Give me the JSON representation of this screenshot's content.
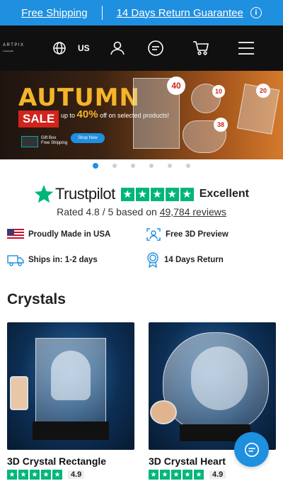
{
  "promo": {
    "free_shipping": "Free Shipping",
    "returns": "14 Days Return Guarantee",
    "info_icon": "info-icon"
  },
  "nav": {
    "logo_text": "ARTPIX",
    "logo_sub": "crystal gifts",
    "region": "US",
    "icons": [
      "globe-icon",
      "user-icon",
      "chat-icon",
      "cart-icon",
      "menu-icon"
    ]
  },
  "hero": {
    "headline": "AUTUMN",
    "sale": "SALE",
    "sale_detail_pre": "up to",
    "sale_percent": "40%",
    "sale_detail_post": "off on selected products!",
    "gift_line1": "Gift Box",
    "gift_line2": "Free Shipping",
    "shop_button": "Shop Now",
    "tag_40": "40",
    "tag_10": "10",
    "tag_20": "20",
    "tag_38": "38"
  },
  "carousel": {
    "count": 6,
    "active": 0
  },
  "trustpilot": {
    "brand": "Trustpilot",
    "rating_word": "Excellent",
    "rated_prefix": "Rated 4.8 / 5 based on ",
    "reviews": "49,784 reviews"
  },
  "features": [
    {
      "icon": "usa-flag-icon",
      "label": "Proudly Made in USA"
    },
    {
      "icon": "preview-3d-icon",
      "label": "Free 3D Preview"
    },
    {
      "icon": "truck-icon",
      "label": "Ships in: 1-2 days"
    },
    {
      "icon": "badge-icon",
      "label": "14 Days Return"
    }
  ],
  "section_title": "Crystals",
  "products": [
    {
      "title": "3D Crystal Rectangle",
      "rating": "4.9"
    },
    {
      "title": "3D Crystal Heart",
      "rating": "4.9"
    }
  ],
  "colors": {
    "accent": "#1f8fe0",
    "trustpilot_green": "#00b67a",
    "sale_red": "#d0241d"
  }
}
